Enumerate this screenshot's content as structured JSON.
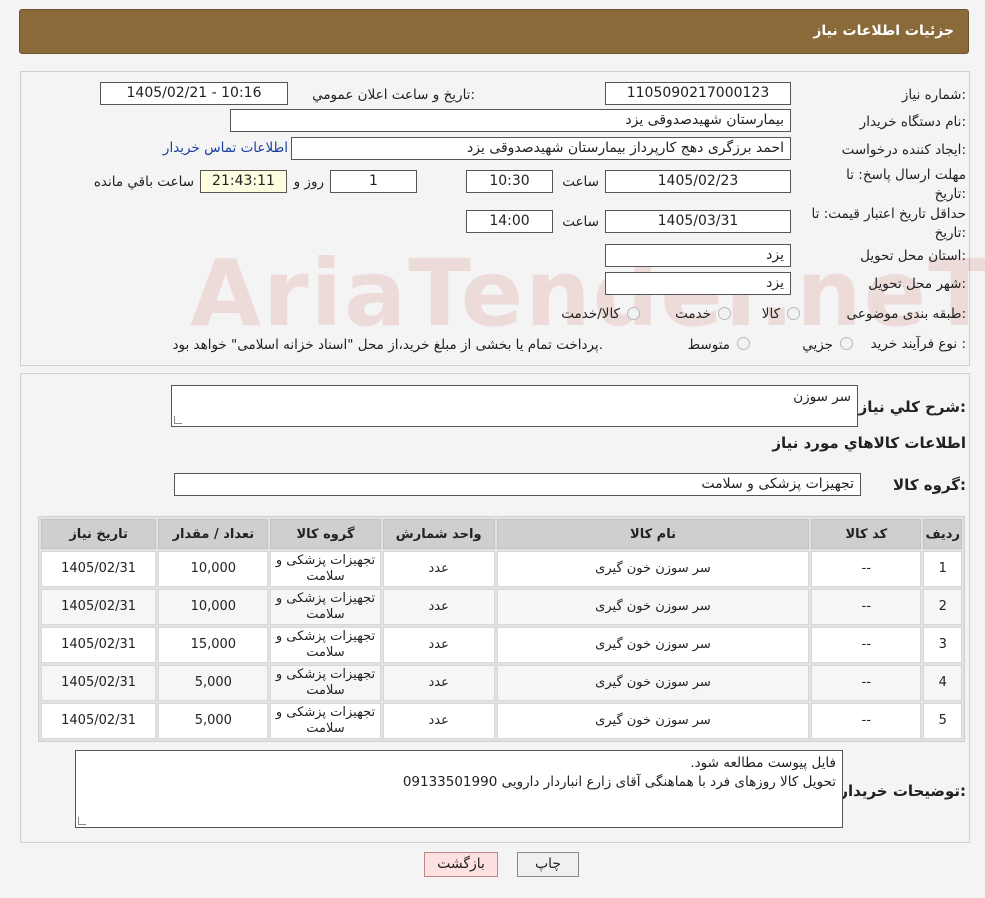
{
  "header": {
    "title": "جزئیات اطلاعات نیاز"
  },
  "form": {
    "need_number_label": "شماره نیاز:",
    "need_number": "1105090217000123",
    "announce_label": "تاریخ و ساعت اعلان عمومي:",
    "announce_value": "1405/02/21 - 10:16",
    "buyer_org_label": "نام دستگاه خريدار:",
    "buyer_org": "بیمارستان شهیدصدوقی یزد",
    "creator_label": "ايجاد کننده درخواست:",
    "creator": "احمد برزگری دهج کارپرداز بیمارستان شهیدصدوقی یزد",
    "contact_link": "اطلاعات تماس خريدار",
    "deadline_label": "مهلت ارسال پاسخ: تا تاریخ:",
    "deadline_date": "1405/02/23",
    "time_label": "ساعت",
    "deadline_time": "10:30",
    "days_value": "1",
    "days_label": "روز و",
    "remaining_time": "21:43:11",
    "remaining_label": "ساعت باقي مانده",
    "validity_label": "حداقل تاريخ اعتبار قيمت: تا تاریخ:",
    "validity_date": "1405/03/31",
    "validity_time": "14:00",
    "province_label": "استان محل تحويل:",
    "province": "یزد",
    "city_label": "شهر محل تحويل:",
    "city": "یزد",
    "category_label": "طبقه بندی موضوعی:",
    "category_options": [
      "کالا",
      "خدمت",
      "کالا/خدمت"
    ],
    "process_label": "نوع فرآيند خريد :",
    "process_options": [
      "جزيي",
      "متوسط"
    ],
    "process_note": "پرداخت تمام یا بخشی از مبلغ خرید،از محل \"اسناد خزانه اسلامی\" خواهد بود."
  },
  "need": {
    "summary_label": "شرح کلي نياز:",
    "summary": "سر سوزن",
    "items_title": "اطلاعات کالاهاي مورد نياز",
    "group_label": "گروه کالا:",
    "group": "تجهیزات پزشکی و سلامت"
  },
  "table": {
    "headers": [
      "رديف",
      "کد کالا",
      "نام کالا",
      "واحد شمارش",
      "گروه کالا",
      "تعداد / مقدار",
      "تاریخ نیاز"
    ],
    "rows": [
      [
        "1",
        "--",
        "سر سوزن خون گیری",
        "عدد",
        "تجهیزات پزشکی و سلامت",
        "10,000",
        "1405/02/31"
      ],
      [
        "2",
        "--",
        "سر سوزن خون گیری",
        "عدد",
        "تجهیزات پزشکی و سلامت",
        "10,000",
        "1405/02/31"
      ],
      [
        "3",
        "--",
        "سر سوزن خون گیری",
        "عدد",
        "تجهیزات پزشکی و سلامت",
        "15,000",
        "1405/02/31"
      ],
      [
        "4",
        "--",
        "سر سوزن خون گیری",
        "عدد",
        "تجهیزات پزشکی و سلامت",
        "5,000",
        "1405/02/31"
      ],
      [
        "5",
        "--",
        "سر سوزن خون گیری",
        "عدد",
        "تجهیزات پزشکی و سلامت",
        "5,000",
        "1405/02/31"
      ]
    ]
  },
  "notes": {
    "label": "توضيحات خريدار:",
    "line1": "فایل پیوست مطالعه شود.",
    "line2": "تحویل کالا روزهای فرد با هماهنگی آقای زارع انباردار دارویی 09133501990"
  },
  "buttons": {
    "print": "چاپ",
    "back": "بازگشت"
  },
  "watermark": "AriaTender.neT"
}
